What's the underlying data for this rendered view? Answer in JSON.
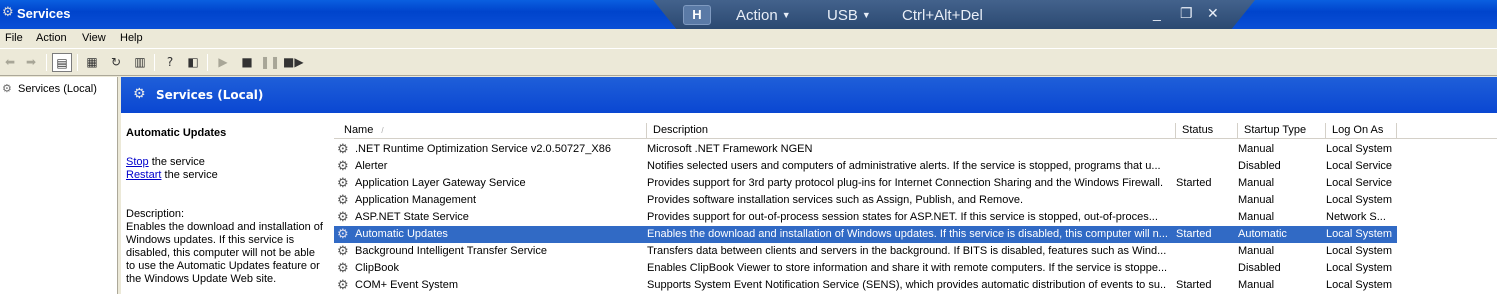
{
  "window": {
    "title": "Services",
    "icon": "gear-icon"
  },
  "remote_bar": {
    "pin_label": "H",
    "menu_action": "Action",
    "menu_usb": "USB",
    "menu_cad": "Ctrl+Alt+Del",
    "minimize": "_",
    "restore": "❐",
    "close": "✕"
  },
  "menubar": {
    "file": "File",
    "action": "Action",
    "view": "View",
    "help": "Help"
  },
  "tree": {
    "root_label": "Services (Local)"
  },
  "panel": {
    "header": "Services (Local)"
  },
  "extended": {
    "service_title": "Automatic Updates",
    "stop_link": "Stop",
    "stop_rest": " the service",
    "restart_link": "Restart",
    "restart_rest": " the service",
    "description_label": "Description:",
    "description_text": "Enables the download and installation of Windows updates. If this service is disabled, this computer will not be able to use the Automatic Updates feature or the Windows Update Web site."
  },
  "columns": {
    "name": "Name",
    "description": "Description",
    "status": "Status",
    "startup": "Startup Type",
    "logon": "Log On As"
  },
  "services": [
    {
      "name": ".NET Runtime Optimization Service v2.0.50727_X86",
      "description": "Microsoft .NET Framework NGEN",
      "status": "",
      "startup": "Manual",
      "logon": "Local System"
    },
    {
      "name": "Alerter",
      "description": "Notifies selected users and computers of administrative alerts. If the service is stopped, programs that u...",
      "status": "",
      "startup": "Disabled",
      "logon": "Local Service"
    },
    {
      "name": "Application Layer Gateway Service",
      "description": "Provides support for 3rd party protocol plug-ins for Internet Connection Sharing and the Windows Firewall.",
      "status": "Started",
      "startup": "Manual",
      "logon": "Local Service"
    },
    {
      "name": "Application Management",
      "description": "Provides software installation services such as Assign, Publish, and Remove.",
      "status": "",
      "startup": "Manual",
      "logon": "Local System"
    },
    {
      "name": "ASP.NET State Service",
      "description": "Provides support for out-of-process session states for ASP.NET. If this service is stopped, out-of-proces...",
      "status": "",
      "startup": "Manual",
      "logon": "Network S..."
    },
    {
      "name": "Automatic Updates",
      "description": "Enables the download and installation of Windows updates. If this service is disabled, this computer will n...",
      "status": "Started",
      "startup": "Automatic",
      "logon": "Local System",
      "selected": true
    },
    {
      "name": "Background Intelligent Transfer Service",
      "description": "Transfers data between clients and servers in the background. If BITS is disabled, features such as Wind...",
      "status": "",
      "startup": "Manual",
      "logon": "Local System"
    },
    {
      "name": "ClipBook",
      "description": "Enables ClipBook Viewer to store information and share it with remote computers. If the service is stoppe...",
      "status": "",
      "startup": "Disabled",
      "logon": "Local System"
    },
    {
      "name": "COM+ Event System",
      "description": "Supports System Event Notification Service (SENS), which provides automatic distribution of events to su...",
      "status": "Started",
      "startup": "Manual",
      "logon": "Local System"
    }
  ]
}
